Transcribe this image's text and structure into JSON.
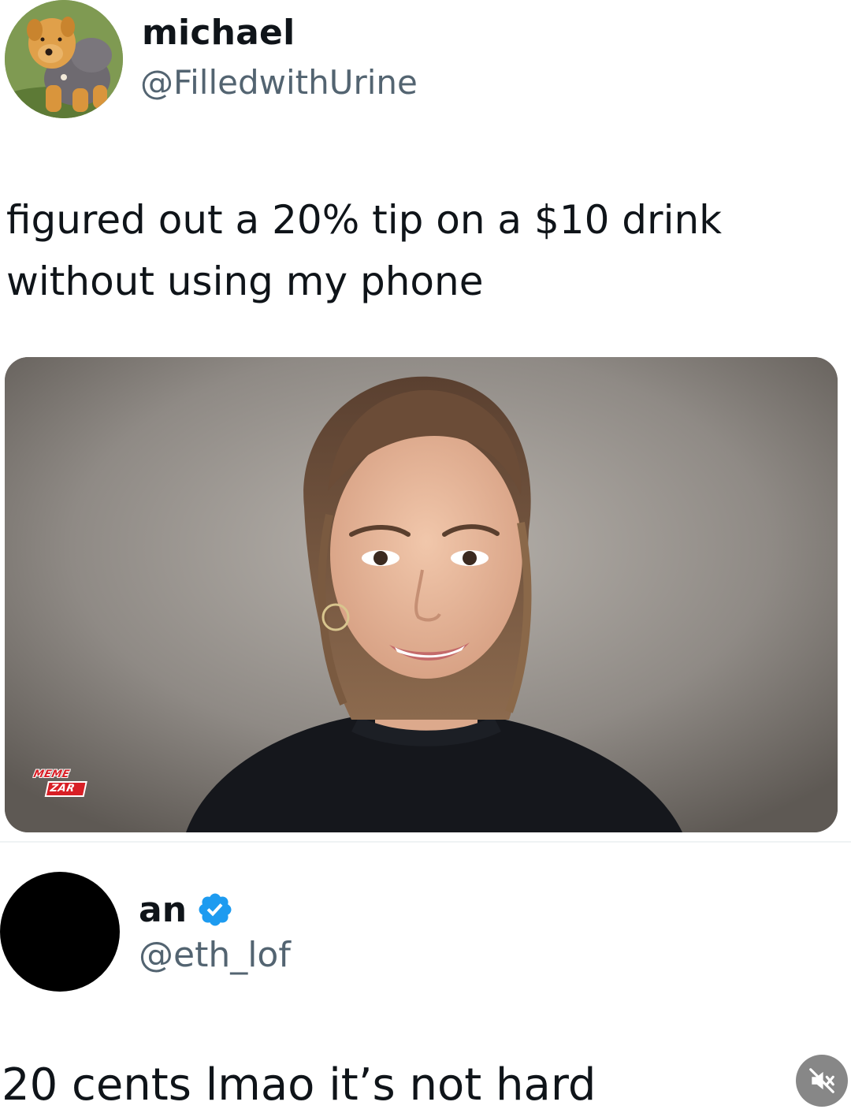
{
  "tweet_1": {
    "display_name": "michael",
    "handle": "@FilledwithUrine",
    "text_line_1": "figured out a 20% tip on a $10 drink",
    "text_line_2": "without using my phone",
    "avatar_icon": "plush-dog-avatar",
    "media_watermark_line_1": "MEME",
    "media_watermark_line_2": "ZAR"
  },
  "tweet_2": {
    "display_name": "an",
    "handle": "@eth_lof",
    "verified": true,
    "verified_color": "#1d9bf0",
    "text": "20 cents lmao it’s not hard"
  },
  "overlay": {
    "mute_icon": "speaker-muted-icon"
  },
  "colors": {
    "primary_text": "#0f1419",
    "secondary_text": "#536471",
    "watermark_red": "#d81f26"
  }
}
